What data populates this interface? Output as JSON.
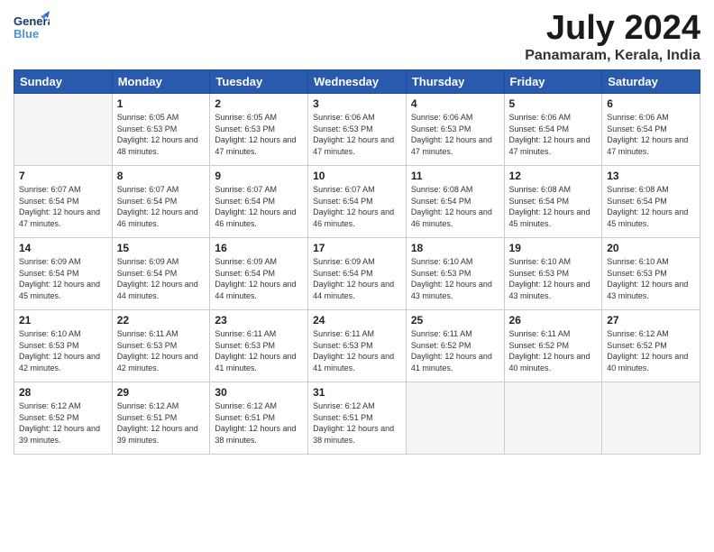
{
  "header": {
    "logo_general": "General",
    "logo_blue": "Blue",
    "month_title": "July 2024",
    "location": "Panamaram, Kerala, India"
  },
  "calendar": {
    "days_of_week": [
      "Sunday",
      "Monday",
      "Tuesday",
      "Wednesday",
      "Thursday",
      "Friday",
      "Saturday"
    ],
    "weeks": [
      [
        {
          "day": "",
          "empty": true
        },
        {
          "day": "1",
          "sunrise": "6:05 AM",
          "sunset": "6:53 PM",
          "daylight": "12 hours and 48 minutes."
        },
        {
          "day": "2",
          "sunrise": "6:05 AM",
          "sunset": "6:53 PM",
          "daylight": "12 hours and 47 minutes."
        },
        {
          "day": "3",
          "sunrise": "6:06 AM",
          "sunset": "6:53 PM",
          "daylight": "12 hours and 47 minutes."
        },
        {
          "day": "4",
          "sunrise": "6:06 AM",
          "sunset": "6:53 PM",
          "daylight": "12 hours and 47 minutes."
        },
        {
          "day": "5",
          "sunrise": "6:06 AM",
          "sunset": "6:54 PM",
          "daylight": "12 hours and 47 minutes."
        },
        {
          "day": "6",
          "sunrise": "6:06 AM",
          "sunset": "6:54 PM",
          "daylight": "12 hours and 47 minutes."
        }
      ],
      [
        {
          "day": "7",
          "sunrise": "6:07 AM",
          "sunset": "6:54 PM",
          "daylight": "12 hours and 47 minutes."
        },
        {
          "day": "8",
          "sunrise": "6:07 AM",
          "sunset": "6:54 PM",
          "daylight": "12 hours and 46 minutes."
        },
        {
          "day": "9",
          "sunrise": "6:07 AM",
          "sunset": "6:54 PM",
          "daylight": "12 hours and 46 minutes."
        },
        {
          "day": "10",
          "sunrise": "6:07 AM",
          "sunset": "6:54 PM",
          "daylight": "12 hours and 46 minutes."
        },
        {
          "day": "11",
          "sunrise": "6:08 AM",
          "sunset": "6:54 PM",
          "daylight": "12 hours and 46 minutes."
        },
        {
          "day": "12",
          "sunrise": "6:08 AM",
          "sunset": "6:54 PM",
          "daylight": "12 hours and 45 minutes."
        },
        {
          "day": "13",
          "sunrise": "6:08 AM",
          "sunset": "6:54 PM",
          "daylight": "12 hours and 45 minutes."
        }
      ],
      [
        {
          "day": "14",
          "sunrise": "6:09 AM",
          "sunset": "6:54 PM",
          "daylight": "12 hours and 45 minutes."
        },
        {
          "day": "15",
          "sunrise": "6:09 AM",
          "sunset": "6:54 PM",
          "daylight": "12 hours and 44 minutes."
        },
        {
          "day": "16",
          "sunrise": "6:09 AM",
          "sunset": "6:54 PM",
          "daylight": "12 hours and 44 minutes."
        },
        {
          "day": "17",
          "sunrise": "6:09 AM",
          "sunset": "6:54 PM",
          "daylight": "12 hours and 44 minutes."
        },
        {
          "day": "18",
          "sunrise": "6:10 AM",
          "sunset": "6:53 PM",
          "daylight": "12 hours and 43 minutes."
        },
        {
          "day": "19",
          "sunrise": "6:10 AM",
          "sunset": "6:53 PM",
          "daylight": "12 hours and 43 minutes."
        },
        {
          "day": "20",
          "sunrise": "6:10 AM",
          "sunset": "6:53 PM",
          "daylight": "12 hours and 43 minutes."
        }
      ],
      [
        {
          "day": "21",
          "sunrise": "6:10 AM",
          "sunset": "6:53 PM",
          "daylight": "12 hours and 42 minutes."
        },
        {
          "day": "22",
          "sunrise": "6:11 AM",
          "sunset": "6:53 PM",
          "daylight": "12 hours and 42 minutes."
        },
        {
          "day": "23",
          "sunrise": "6:11 AM",
          "sunset": "6:53 PM",
          "daylight": "12 hours and 41 minutes."
        },
        {
          "day": "24",
          "sunrise": "6:11 AM",
          "sunset": "6:53 PM",
          "daylight": "12 hours and 41 minutes."
        },
        {
          "day": "25",
          "sunrise": "6:11 AM",
          "sunset": "6:52 PM",
          "daylight": "12 hours and 41 minutes."
        },
        {
          "day": "26",
          "sunrise": "6:11 AM",
          "sunset": "6:52 PM",
          "daylight": "12 hours and 40 minutes."
        },
        {
          "day": "27",
          "sunrise": "6:12 AM",
          "sunset": "6:52 PM",
          "daylight": "12 hours and 40 minutes."
        }
      ],
      [
        {
          "day": "28",
          "sunrise": "6:12 AM",
          "sunset": "6:52 PM",
          "daylight": "12 hours and 39 minutes."
        },
        {
          "day": "29",
          "sunrise": "6:12 AM",
          "sunset": "6:51 PM",
          "daylight": "12 hours and 39 minutes."
        },
        {
          "day": "30",
          "sunrise": "6:12 AM",
          "sunset": "6:51 PM",
          "daylight": "12 hours and 38 minutes."
        },
        {
          "day": "31",
          "sunrise": "6:12 AM",
          "sunset": "6:51 PM",
          "daylight": "12 hours and 38 minutes."
        },
        {
          "day": "",
          "empty": true
        },
        {
          "day": "",
          "empty": true
        },
        {
          "day": "",
          "empty": true
        }
      ]
    ]
  }
}
